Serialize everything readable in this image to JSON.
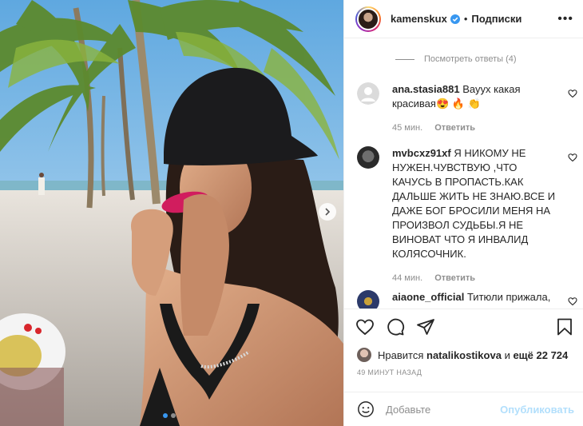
{
  "post": {
    "username": "kamenskux",
    "separator": "•",
    "follow_state": "Подписки",
    "more": "•••"
  },
  "comments_section": {
    "view_replies": "Посмотреть ответы (4)",
    "items": [
      {
        "user": "ana.stasia881",
        "text": "Вауух какая красивая😍 🔥 👏",
        "time": "45 мин.",
        "reply": "Ответить"
      },
      {
        "user": "mvbcxz91xf",
        "text": "Я НИКОМУ НЕ НУЖЕН.ЧУВСТВУЮ ,ЧТО КАЧУСЬ В ПРОПАСТЬ.КАК ДАЛЬШЕ ЖИТЬ НЕ ЗНАЮ.ВСЕ И ДАЖЕ БОГ БРОСИЛИ МЕНЯ НА ПРОИЗВОЛ СУДЬБЫ.Я НЕ ВИНОВАТ ЧТО Я ИНВАЛИД КОЛЯСОЧНИК.",
        "time": "44 мин.",
        "reply": "Ответить"
      },
      {
        "user": "aiaone_official",
        "text": "Титюли прижала,",
        "time": "",
        "reply": ""
      }
    ]
  },
  "likes": {
    "prefix": "Нравится",
    "liker": "natalikostikova",
    "connector": "и",
    "others": "ещё 22 724"
  },
  "time_ago": "49 МИНУТ НАЗАД",
  "composer": {
    "placeholder": "Добавьте",
    "post_button": "Опубликовать"
  },
  "carousel": {
    "slide_count": 2,
    "active_index": 0
  },
  "colors": {
    "accent_blue": "#3897f0",
    "post_disabled": "#b2dffc",
    "muted": "#8e8e8e",
    "text": "#262626",
    "border": "#efefef"
  },
  "icons": [
    "heart-icon",
    "comment-icon",
    "share-icon",
    "bookmark-icon",
    "emoji-icon",
    "verified-icon",
    "more-icon",
    "chevron-right-icon"
  ]
}
